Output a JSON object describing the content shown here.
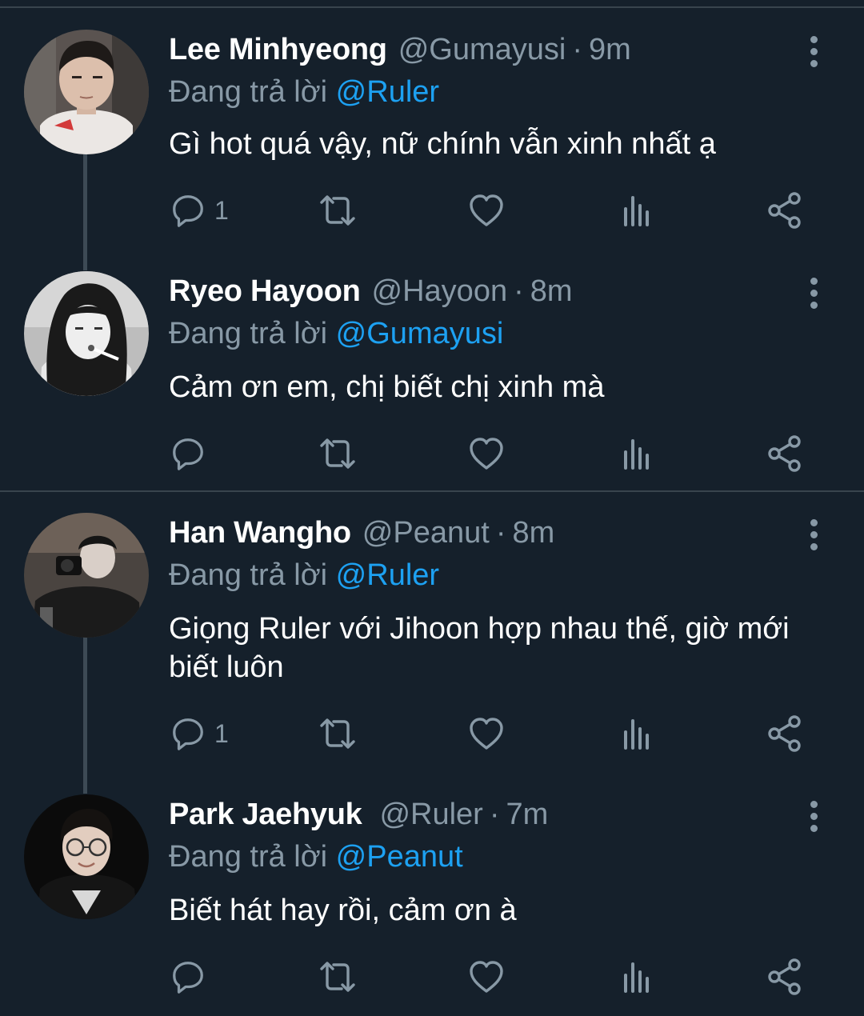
{
  "tweets": [
    {
      "name": "Lee Minhyeong",
      "handle": "@Gumayusi",
      "time": "9m",
      "reply_prefix": "Đang trả lời",
      "reply_to": "@Ruler",
      "text": "Gì hot quá vậy, nữ chính vẫn xinh nhất ạ",
      "reply_count": "1"
    },
    {
      "name": "Ryeo Hayoon",
      "handle": "@Hayoon",
      "time": "8m",
      "reply_prefix": "Đang trả lời",
      "reply_to": "@Gumayusi",
      "text": "Cảm ơn em, chị biết chị xinh mà",
      "reply_count": ""
    },
    {
      "name": "Han Wangho",
      "handle": "@Peanut",
      "time": "8m",
      "reply_prefix": "Đang trả lời",
      "reply_to": "@Ruler",
      "text": "Giọng Ruler với Jihoon hợp nhau thế, giờ mới biết luôn",
      "reply_count": "1"
    },
    {
      "name": "Park Jaehyuk",
      "handle": "@Ruler",
      "time": "7m",
      "reply_prefix": "Đang trả lời",
      "reply_to": "@Peanut",
      "text": "Biết hát hay rồi, cảm ơn à",
      "reply_count": ""
    }
  ],
  "separator": "·",
  "icons": [
    "reply-icon",
    "retweet-icon",
    "like-icon",
    "analytics-icon",
    "share-icon",
    "more-options-icon"
  ],
  "colors": {
    "background": "#15202b",
    "secondary_text": "#8899a6",
    "link": "#1da1f2",
    "divider": "#38444d"
  }
}
